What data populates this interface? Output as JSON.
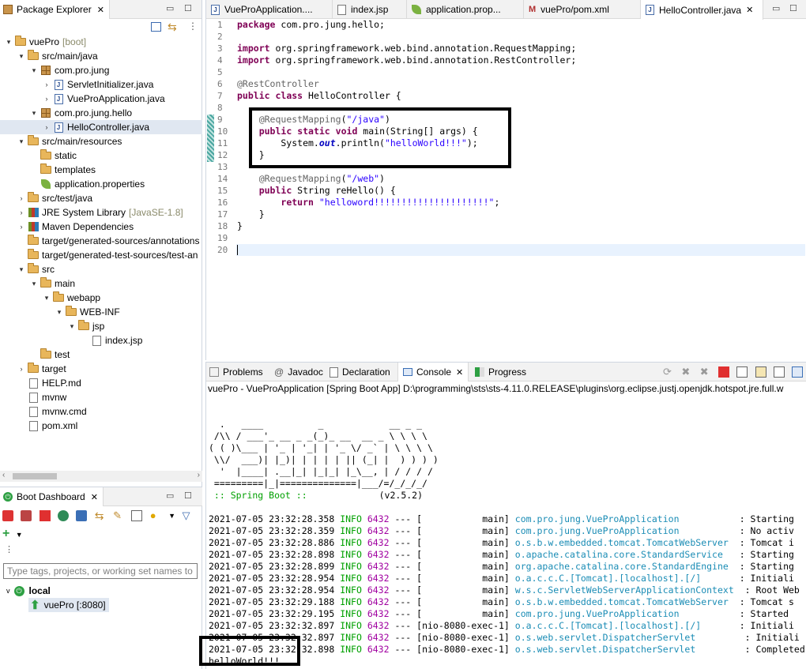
{
  "package_explorer": {
    "title": "Package Explorer",
    "tree": [
      {
        "label": "vuePro",
        "suffix": "[boot]",
        "indent": 0,
        "twisty": "v",
        "icon": "project"
      },
      {
        "label": "src/main/java",
        "indent": 1,
        "twisty": "v",
        "icon": "srcfolder"
      },
      {
        "label": "com.pro.jung",
        "indent": 2,
        "twisty": "v",
        "icon": "package"
      },
      {
        "label": "ServletInitializer.java",
        "indent": 3,
        "twisty": ">",
        "icon": "java"
      },
      {
        "label": "VueProApplication.java",
        "indent": 3,
        "twisty": ">",
        "icon": "java"
      },
      {
        "label": "com.pro.jung.hello",
        "indent": 2,
        "twisty": "v",
        "icon": "package"
      },
      {
        "label": "HelloController.java",
        "indent": 3,
        "twisty": ">",
        "icon": "java",
        "selected": true
      },
      {
        "label": "src/main/resources",
        "indent": 1,
        "twisty": "v",
        "icon": "srcfolder"
      },
      {
        "label": "static",
        "indent": 2,
        "twisty": "",
        "icon": "folder"
      },
      {
        "label": "templates",
        "indent": 2,
        "twisty": "",
        "icon": "folder"
      },
      {
        "label": "application.properties",
        "indent": 2,
        "twisty": "",
        "icon": "leaf"
      },
      {
        "label": "src/test/java",
        "indent": 1,
        "twisty": ">",
        "icon": "srcfolder"
      },
      {
        "label": "JRE System Library",
        "suffix": "[JavaSE-1.8]",
        "indent": 1,
        "twisty": ">",
        "icon": "lib"
      },
      {
        "label": "Maven Dependencies",
        "indent": 1,
        "twisty": ">",
        "icon": "lib"
      },
      {
        "label": "target/generated-sources/annotations",
        "indent": 1,
        "twisty": "",
        "icon": "srcfolder"
      },
      {
        "label": "target/generated-test-sources/test-an",
        "indent": 1,
        "twisty": "",
        "icon": "srcfolder"
      },
      {
        "label": "src",
        "indent": 1,
        "twisty": "v",
        "icon": "folder"
      },
      {
        "label": "main",
        "indent": 2,
        "twisty": "v",
        "icon": "folder"
      },
      {
        "label": "webapp",
        "indent": 3,
        "twisty": "v",
        "icon": "folder"
      },
      {
        "label": "WEB-INF",
        "indent": 4,
        "twisty": "v",
        "icon": "folder"
      },
      {
        "label": "jsp",
        "indent": 5,
        "twisty": "v",
        "icon": "folder"
      },
      {
        "label": "index.jsp",
        "indent": 6,
        "twisty": "",
        "icon": "doc"
      },
      {
        "label": "test",
        "indent": 2,
        "twisty": "",
        "icon": "folder"
      },
      {
        "label": "target",
        "indent": 1,
        "twisty": ">",
        "icon": "folder"
      },
      {
        "label": "HELP.md",
        "indent": 1,
        "twisty": "",
        "icon": "doc"
      },
      {
        "label": "mvnw",
        "indent": 1,
        "twisty": "",
        "icon": "doc"
      },
      {
        "label": "mvnw.cmd",
        "indent": 1,
        "twisty": "",
        "icon": "doc"
      },
      {
        "label": "pom.xml",
        "indent": 1,
        "twisty": "",
        "icon": "doc"
      }
    ]
  },
  "boot_dashboard": {
    "title": "Boot Dashboard",
    "filter_placeholder": "Type tags, projects, or working set names to",
    "local_label": "local",
    "app_label": "vuePro [:8080]"
  },
  "editor": {
    "tabs": [
      "VueProApplication....",
      "index.jsp",
      "application.prop...",
      "vuePro/pom.xml",
      "HelloController.java"
    ],
    "line_numbers": [
      "1",
      "2",
      "3",
      "4",
      "5",
      "6",
      "7",
      "8",
      "9",
      "10",
      "11",
      "12",
      "13",
      "14",
      "15",
      "16",
      "17",
      "18",
      "19",
      "20"
    ],
    "lines": [
      "package com.pro.jung.hello;",
      "",
      "import org.springframework.web.bind.annotation.RequestMapping;",
      "import org.springframework.web.bind.annotation.RestController;",
      "",
      "@RestController",
      "public class HelloController {",
      "",
      "    @RequestMapping(\"/java\")",
      "    public static void main(String[] args) {",
      "        System.out.println(\"helloWorld!!!\");",
      "    }",
      "",
      "    @RequestMapping(\"/web\")",
      "    public String reHello() {",
      "        return \"helloword!!!!!!!!!!!!!!!!!!!!!\";",
      "    }",
      "}",
      "",
      ""
    ]
  },
  "console": {
    "tabs": [
      "Problems",
      "Javadoc",
      "Declaration",
      "Console",
      "Progress"
    ],
    "launch_line": "vuePro - VueProApplication [Spring Boot App] D:\\programming\\sts\\sts-4.11.0.RELEASE\\plugins\\org.eclipse.justj.openjdk.hotspot.jre.full.w",
    "banner": [
      "",
      "  .   ____          _            __ _ _",
      " /\\\\ / ___'_ __ _ _(_)_ __  __ _ \\ \\ \\ \\",
      "( ( )\\___ | '_ | '_| | '_ \\/ _` | \\ \\ \\ \\",
      " \\\\/  ___)| |_)| | | | | || (_| |  ) ) ) )",
      "  '  |____| .__|_| |_|_| |_\\__, | / / / /",
      " =========|_|==============|___/=/_/_/_/"
    ],
    "spring_boot": " :: Spring Boot ::",
    "version": "(v2.5.2)",
    "logs": [
      {
        "time": "2021-07-05 23:32:28.358",
        "level": "INFO",
        "pid": "6432",
        "thread": "[           main]",
        "logger": "com.pro.jung.VueProApplication          ",
        "msg": ": Starting"
      },
      {
        "time": "2021-07-05 23:32:28.359",
        "level": "INFO",
        "pid": "6432",
        "thread": "[           main]",
        "logger": "com.pro.jung.VueProApplication          ",
        "msg": ": No activ"
      },
      {
        "time": "2021-07-05 23:32:28.886",
        "level": "INFO",
        "pid": "6432",
        "thread": "[           main]",
        "logger": "o.s.b.w.embedded.tomcat.TomcatWebServer ",
        "msg": ": Tomcat i"
      },
      {
        "time": "2021-07-05 23:32:28.898",
        "level": "INFO",
        "pid": "6432",
        "thread": "[           main]",
        "logger": "o.apache.catalina.core.StandardService  ",
        "msg": ": Starting"
      },
      {
        "time": "2021-07-05 23:32:28.899",
        "level": "INFO",
        "pid": "6432",
        "thread": "[           main]",
        "logger": "org.apache.catalina.core.StandardEngine ",
        "msg": ": Starting"
      },
      {
        "time": "2021-07-05 23:32:28.954",
        "level": "INFO",
        "pid": "6432",
        "thread": "[           main]",
        "logger": "o.a.c.c.C.[Tomcat].[localhost].[/]      ",
        "msg": ": Initiali"
      },
      {
        "time": "2021-07-05 23:32:28.954",
        "level": "INFO",
        "pid": "6432",
        "thread": "[           main]",
        "logger": "w.s.c.ServletWebServerApplicationContext ",
        "msg": ": Root Web"
      },
      {
        "time": "2021-07-05 23:32:29.188",
        "level": "INFO",
        "pid": "6432",
        "thread": "[           main]",
        "logger": "o.s.b.w.embedded.tomcat.TomcatWebServer ",
        "msg": ": Tomcat s"
      },
      {
        "time": "2021-07-05 23:32:29.195",
        "level": "INFO",
        "pid": "6432",
        "thread": "[           main]",
        "logger": "com.pro.jung.VueProApplication          ",
        "msg": ": Started"
      },
      {
        "time": "2021-07-05 23:32:32.897",
        "level": "INFO",
        "pid": "6432",
        "thread": "[nio-8080-exec-1]",
        "logger": "o.a.c.c.C.[Tomcat].[localhost].[/]      ",
        "msg": ": Initiali"
      },
      {
        "time": "2021-07-05 23:32:32.897",
        "level": "INFO",
        "pid": "6432",
        "thread": "[nio-8080-exec-1]",
        "logger": "o.s.web.servlet.DispatcherServlet        ",
        "msg": ": Initiali"
      },
      {
        "time": "2021-07-05 23:32:32.898",
        "level": "INFO",
        "pid": "6432",
        "thread": "[nio-8080-exec-1]",
        "logger": "o.s.web.servlet.DispatcherServlet        ",
        "msg": ": Completed"
      }
    ],
    "output_line": "helloWorld!!!"
  }
}
